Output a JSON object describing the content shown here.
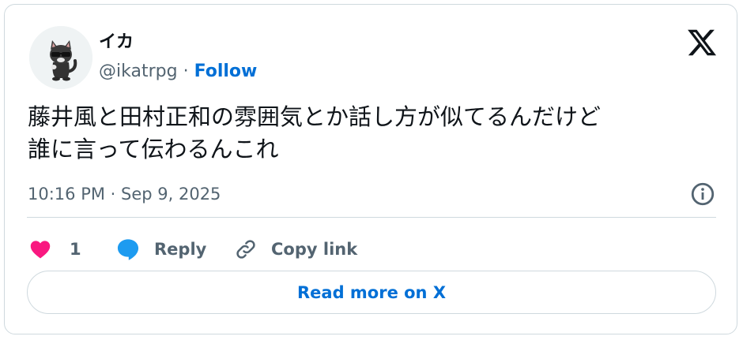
{
  "author": {
    "display_name": "イカ",
    "handle": "@ikatrpg",
    "separator": "·",
    "follow_label": "Follow",
    "avatar_icon": "cartoon-cat-sunglasses-avatar"
  },
  "brand": {
    "logo_icon": "x-logo-icon"
  },
  "tweet": {
    "text": "藤井風と田村正和の雰囲気とか話し方が似てるんだけど\n誰に言って伝わるんこれ",
    "timestamp": "10:16 PM · Sep 9, 2025",
    "info_icon": "info-icon"
  },
  "actions": {
    "like_count": "1",
    "reply_label": "Reply",
    "copy_link_label": "Copy link"
  },
  "read_more_label": "Read more on X",
  "colors": {
    "accent": "#006fd6",
    "like": "#f91880",
    "reply_icon": "#1d9bf0",
    "secondary_text": "#536471",
    "border": "#cfd9de"
  }
}
